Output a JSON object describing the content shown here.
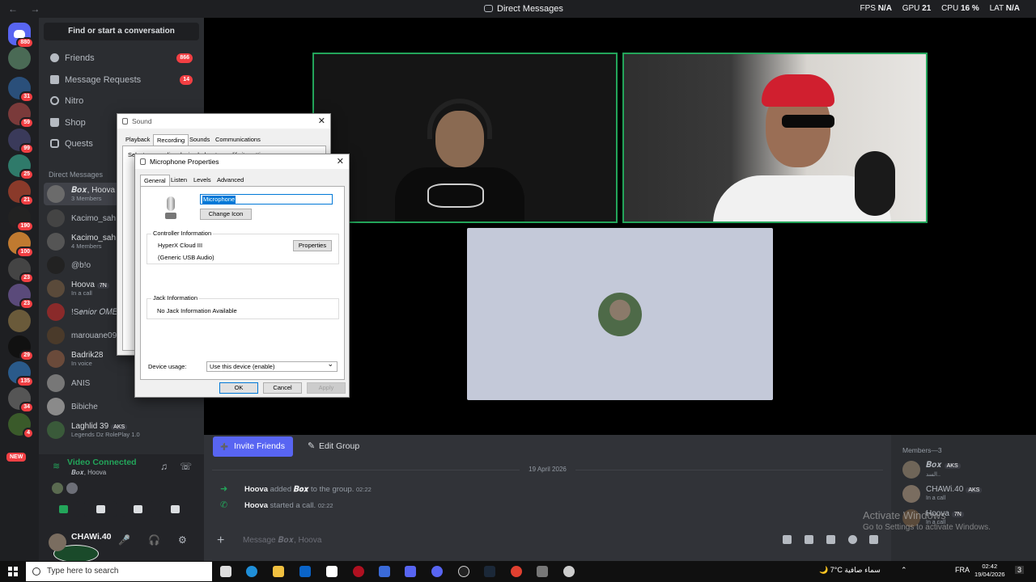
{
  "titlebar": {
    "title": "Direct Messages",
    "stats": [
      "FPS",
      "N/A",
      "GPU",
      "21",
      "CPU",
      "16 %",
      "LAT",
      "N/A"
    ]
  },
  "rail": {
    "home_badge": "880",
    "server_badges": [
      "31",
      "59",
      "99",
      "25",
      "21",
      "190",
      "100",
      "23",
      "23",
      "29",
      "135",
      "34",
      "4"
    ],
    "new_label": "NEW"
  },
  "sidebar": {
    "search_placeholder": "Find or start a conversation",
    "nav": [
      {
        "label": "Friends",
        "count": "866"
      },
      {
        "label": "Message Requests",
        "count": "14"
      },
      {
        "label": "Nitro",
        "count": ""
      },
      {
        "label": "Shop",
        "count": ""
      },
      {
        "label": "Quests",
        "count": ""
      }
    ],
    "dm_header": "Direct Messages",
    "dms": [
      {
        "name": "𝑩𝒐𝒙, Hoova",
        "sub": "3 Members",
        "active": true
      },
      {
        "name": "Kacimo_sah",
        "sub": ""
      },
      {
        "name": "Kacimo_sah",
        "sub": "4 Members"
      },
      {
        "name": "@b!o",
        "sub": ""
      },
      {
        "name": "Hoova",
        "sub": "In a call",
        "tag": "7N"
      },
      {
        "name": "!S𝑒𝑛𝑖𝑜𝑟 𝑂𝑀𝐸",
        "sub": ""
      },
      {
        "name": "marouane09",
        "sub": ""
      },
      {
        "name": "Badrik28",
        "sub": "In voice"
      },
      {
        "name": "ANIS",
        "sub": ""
      },
      {
        "name": "Bibiche",
        "sub": ""
      },
      {
        "name": "Laghlid 39",
        "sub": "Legends Dz RolePlay 1.0",
        "tag": "AKS"
      }
    ]
  },
  "voice": {
    "status": "Video Connected",
    "channel": "𝑩𝒐𝒙, Hoova"
  },
  "user": {
    "name": "CHAWi.40"
  },
  "chat": {
    "invite_label": "Invite Friends",
    "edit_label": "Edit Group",
    "date": "19 April 2026",
    "messages": [
      {
        "author": "Hoova",
        "text": " added ",
        "target": "𝑩𝒐𝒙",
        "rest": " to the group.",
        "time": "02:22"
      },
      {
        "author": "Hoova",
        "text": " started a call.",
        "target": "",
        "rest": "",
        "time": "02:22"
      }
    ],
    "composer_placeholder": "Message 𝑩𝒐𝒙, Hoova"
  },
  "members": {
    "header": "Members—3",
    "list": [
      {
        "name": "𝑩𝒐𝒙",
        "tag": "AKS",
        "sub": "السد.."
      },
      {
        "name": "CHAWi.40",
        "tag": "AKS",
        "sub": "In a call"
      },
      {
        "name": "Hoova",
        "tag": "7N",
        "sub": "In a call"
      }
    ]
  },
  "watermark": {
    "line1": "Activate Windows",
    "line2": "Go to Settings to activate Windows."
  },
  "sound_dialog": {
    "title": "Sound",
    "tabs": [
      "Playback",
      "Recording",
      "Sounds",
      "Communications"
    ],
    "selected_tab": "Recording",
    "hint": "Select a recording device below to modify its settings:"
  },
  "mic_dialog": {
    "title": "Microphone Properties",
    "tabs": [
      "General",
      "Listen",
      "Levels",
      "Advanced"
    ],
    "name_value": "Microphone",
    "change_icon": "Change Icon",
    "controller_header": "Controller Information",
    "controller_name": "HyperX Cloud III",
    "controller_driver": "(Generic USB Audio)",
    "properties_button": "Properties",
    "jack_header": "Jack Information",
    "jack_text": "No Jack Information Available",
    "usage_label": "Device usage:",
    "usage_value": "Use this device (enable)",
    "ok": "OK",
    "cancel": "Cancel",
    "apply": "Apply"
  },
  "taskbar": {
    "search_placeholder": "Type here to search",
    "weather": "7°C  سماء صافية",
    "lang": "FRA",
    "time": "02:42",
    "date": "19/04/2026",
    "notif_count": "3"
  }
}
